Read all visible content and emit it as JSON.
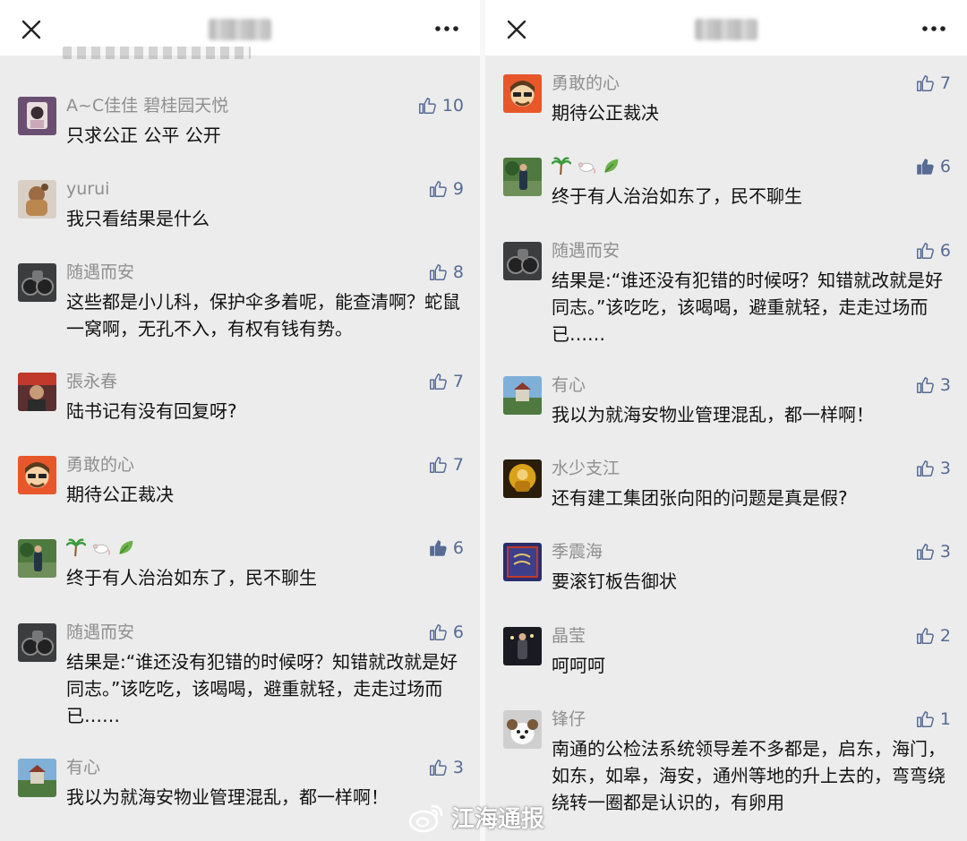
{
  "left": {
    "comments": [
      {
        "name": "A~C佳佳  碧桂园天悦",
        "likes": "10",
        "text": "只求公正 公平 公开",
        "liked": false
      },
      {
        "name": "yurui",
        "likes": "9",
        "text": "我只看结果是什么",
        "liked": false
      },
      {
        "name": "随遇而安",
        "likes": "8",
        "text": "这些都是小儿科，保护伞多着呢，能查清啊？蛇鼠一窝啊，无孔不入，有权有钱有势。",
        "liked": false
      },
      {
        "name": "張永春",
        "likes": "7",
        "text": "陆书记有没有回复呀?",
        "liked": false
      },
      {
        "name": "勇敢的心",
        "likes": "7",
        "text": "期待公正裁决",
        "liked": false
      },
      {
        "name": "",
        "likes": "6",
        "text": "终于有人治治如东了，民不聊生",
        "liked": true,
        "emoji_name": [
          "palm-tree-icon",
          "rat-icon",
          "leaf-icon"
        ]
      },
      {
        "name": "随遇而安",
        "likes": "6",
        "text": "结果是:“谁还没有犯错的时候呀？知错就改就是好同志。”该吃吃，该喝喝，避重就轻，走走过场而已……",
        "liked": false
      },
      {
        "name": "有心",
        "likes": "3",
        "text": "我以为就海安物业管理混乱，都一样啊！",
        "liked": false
      }
    ]
  },
  "right": {
    "comments": [
      {
        "name": "勇敢的心",
        "likes": "7",
        "text": "期待公正裁决",
        "liked": false
      },
      {
        "name": "",
        "likes": "6",
        "text": "终于有人治治如东了，民不聊生",
        "liked": true,
        "emoji_name": [
          "palm-tree-icon",
          "rat-icon",
          "leaf-icon"
        ]
      },
      {
        "name": "随遇而安",
        "likes": "6",
        "text": "结果是:“谁还没有犯错的时候呀？知错就改就是好同志。”该吃吃，该喝喝，避重就轻，走走过场而已……",
        "liked": false
      },
      {
        "name": "有心",
        "likes": "3",
        "text": "我以为就海安物业管理混乱，都一样啊！",
        "liked": false
      },
      {
        "name": "水少支江",
        "likes": "3",
        "text": "还有建工集团张向阳的问题是真是假?",
        "liked": false
      },
      {
        "name": "季震海",
        "likes": "3",
        "text": "要滚钉板告御状",
        "liked": false
      },
      {
        "name": "晶莹",
        "likes": "2",
        "text": "呵呵呵",
        "liked": false
      },
      {
        "name": "锋仔",
        "likes": "1",
        "text": "南通的公检法系统领导差不多都是，启东，海门，如东，如皋，海安，通州等地的升上去的，弯弯绕绕转一圈都是认识的，有卵用",
        "liked": false
      }
    ]
  },
  "watermark": {
    "text": "江海通报",
    "icon": "weibo-icon"
  },
  "colors": {
    "like": "#576b95",
    "name": "#8f8f8f",
    "background": "#ececec",
    "header": "#ffffff"
  }
}
